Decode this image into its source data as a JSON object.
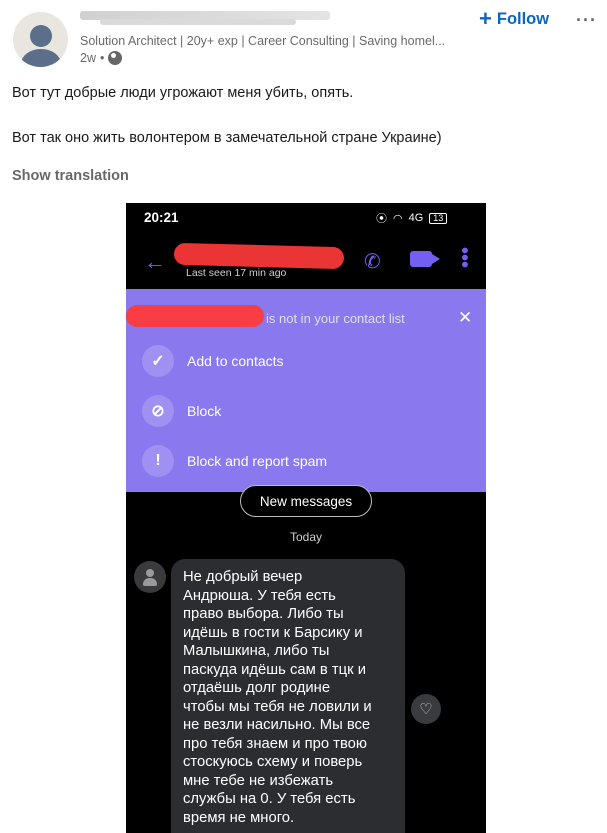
{
  "post": {
    "author_headline": "Solution Architect | 20y+ exp | Career Consulting | Saving homel...",
    "time_ago": "2w",
    "dot": "•",
    "follow_label": "Follow",
    "follow_plus": "+",
    "more_label": "···",
    "text_line_1": "Вот тут добрые люди угрожают меня убить, опять.",
    "text_line_2": "Вот так оно жить волонтером в замечательной стране Украине)",
    "show_translation": "Show translation"
  },
  "phone": {
    "status_time": "20:21",
    "status_network": "4G",
    "battery": "13",
    "last_seen": "Last seen 17 min ago",
    "banner": {
      "title": "is not in your contact list",
      "close": "✕",
      "items": [
        {
          "icon": "check-icon",
          "glyph": "✓",
          "label": "Add to contacts"
        },
        {
          "icon": "block-icon",
          "glyph": "⊘",
          "label": "Block"
        },
        {
          "icon": "exclamation-icon",
          "glyph": "!",
          "label": "Block and report spam"
        }
      ]
    },
    "new_messages": "New messages",
    "date_divider": "Today",
    "message_lines": [
      "Не добрый вечер",
      "Андрюша. У тебя есть",
      "право выбора. Либо ты",
      "идёшь в гости к Барсику и",
      "Малышкина, либо ты",
      "паскуда идёшь сам в тцк и",
      "отдаёшь долг родине",
      "чтобы мы тебя не ловили и",
      "не везли насильно. Мы все",
      "про тебя знаем и про твою",
      "стоскуюсь схему и поверь",
      "мне тебе не избежать",
      "службы на 0. У тебя есть",
      "время не много."
    ],
    "accent_color": "#7360f2",
    "banner_color": "#8a78ee"
  }
}
